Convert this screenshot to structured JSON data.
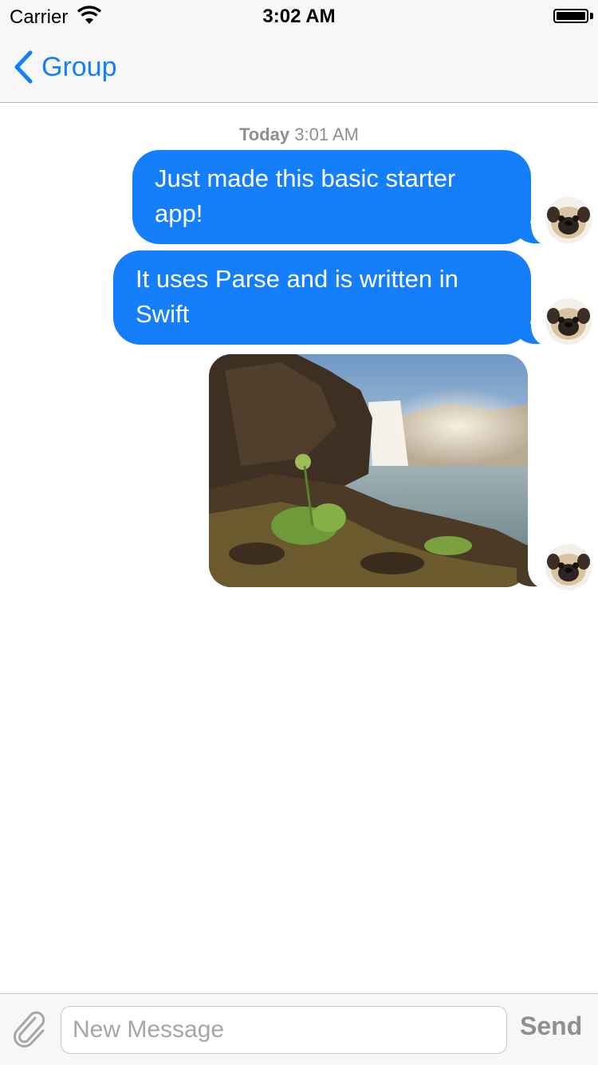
{
  "status_bar": {
    "carrier": "Carrier",
    "time": "3:02 AM",
    "icons": [
      "wifi-icon",
      "battery-icon"
    ]
  },
  "nav": {
    "back_label": "Group",
    "back_icon": "chevron-left-icon"
  },
  "conversation": {
    "timestamp_day": "Today",
    "timestamp_time": "3:01 AM",
    "messages": [
      {
        "type": "text",
        "text": "Just made this basic starter app!",
        "outgoing": true
      },
      {
        "type": "text",
        "text": "It uses Parse and is written in Swift",
        "outgoing": true
      },
      {
        "type": "photo",
        "description": "waterfall-photo",
        "outgoing": true
      }
    ],
    "avatar_icon": "pug-avatar"
  },
  "input": {
    "placeholder": "New Message",
    "value": "",
    "send_label": "Send",
    "attach_icon": "paperclip-icon"
  },
  "colors": {
    "accent": "#157efb",
    "bubble": "#157efb",
    "bar_background": "#f7f7f7",
    "muted_text": "#8e8e93"
  }
}
